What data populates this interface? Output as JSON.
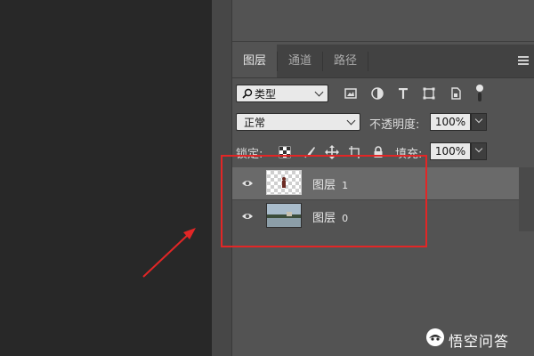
{
  "tabs": [
    {
      "label": "图层",
      "active": true
    },
    {
      "label": "通道",
      "active": false
    },
    {
      "label": "路径",
      "active": false
    }
  ],
  "filter": {
    "kind_label": "类型",
    "icons": [
      "image-filter-icon",
      "adjustment-filter-icon",
      "type-filter-icon",
      "shape-filter-icon",
      "smart-object-filter-icon",
      "filter-toggle-icon"
    ]
  },
  "blend": {
    "mode": "正常",
    "opacity_label": "不透明度:",
    "opacity_value": "100%"
  },
  "lock": {
    "label": "锁定:",
    "fill_label": "填充:",
    "fill_value": "100%"
  },
  "layers": [
    {
      "name": "图层",
      "index": "1",
      "selected": true,
      "visible": true
    },
    {
      "name": "图层",
      "index": "0",
      "selected": false,
      "visible": true
    }
  ],
  "watermark": {
    "text": "悟空问答"
  },
  "colors": {
    "highlight": "#e22626",
    "arrow": "#e22626",
    "panel": "#535353",
    "selected_row": "#6a6a6a"
  }
}
